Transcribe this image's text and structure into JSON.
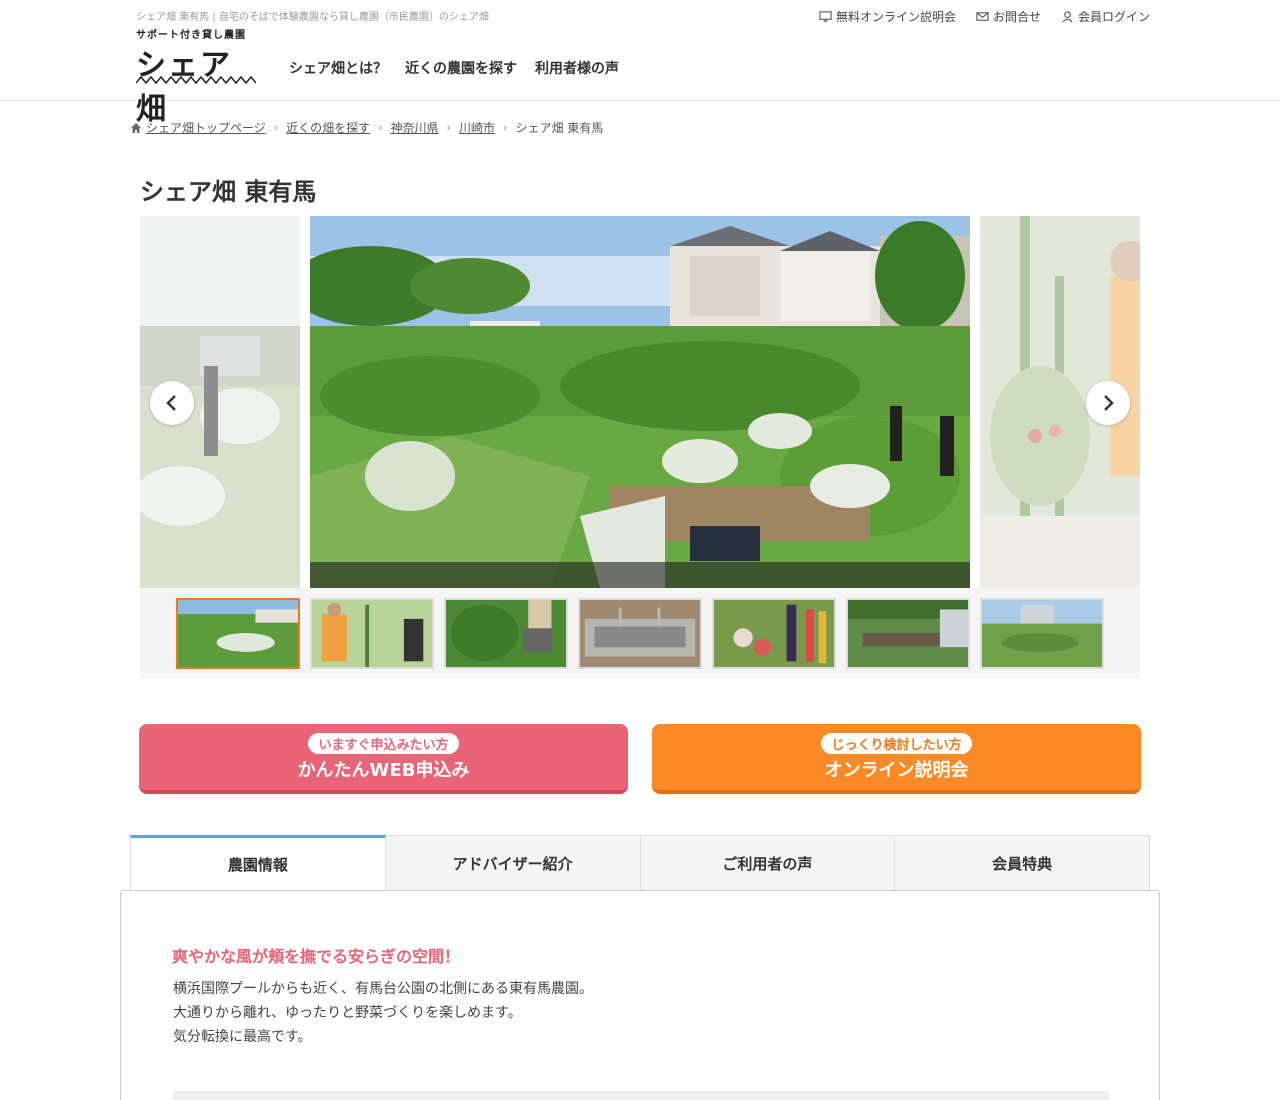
{
  "header": {
    "tagline": "シェア畑 東有馬 | 自宅のそばで体験農園なら貸し農園（市民農園）のシェア畑",
    "logo_sub": "サポート付き貸し農園",
    "logo_main": "シェア畑",
    "nav": [
      "シェア畑とは？",
      "近くの農園を探す",
      "利用者様の声"
    ],
    "util": {
      "online": "無料オンライン説明会",
      "contact": "お問合せ",
      "login": "会員ログイン"
    }
  },
  "breadcrumb": {
    "items": [
      "シェア畑トップページ",
      "近くの畑を探す",
      "神奈川県",
      "川崎市"
    ],
    "current": "シェア畑 東有馬"
  },
  "page_title": "シェア畑 東有馬",
  "gallery": {
    "active_index": 0,
    "thumb_count": 7
  },
  "cta": {
    "web": {
      "pill": "いますぐ申込みたい方",
      "label": "かんたんWEB申込み",
      "color": "#ea6478"
    },
    "online": {
      "pill": "じっくり検討したい方",
      "label": "オンライン説明会",
      "color": "#fb8a26"
    }
  },
  "tabs": [
    "農園情報",
    "アドバイザー紹介",
    "ご利用者の声",
    "会員特典"
  ],
  "active_tab": 0,
  "panel": {
    "heading": "爽やかな風が頬を撫でる安らぎの空間！",
    "lines": [
      "横浜国際プールからも近く、有馬台公園の北側にある東有馬農園。",
      "大通りから離れ、ゆったりと野菜づくりを楽しめます。",
      "気分転換に最高です。"
    ]
  },
  "colors": {
    "accent_pink": "#ea6478",
    "accent_orange": "#fb8a26",
    "tab_active": "#3eb2d9",
    "thumb_active": "#f07a1a"
  }
}
